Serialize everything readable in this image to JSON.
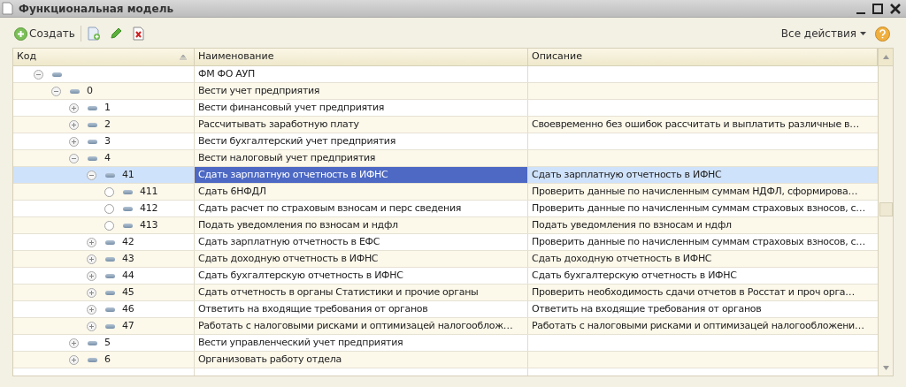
{
  "window": {
    "title": "Функциональная модель"
  },
  "toolbar": {
    "create_label": "Создать",
    "all_actions_label": "Все действия"
  },
  "table": {
    "columns": [
      {
        "label": "Код",
        "sorted": true
      },
      {
        "label": "Наименование",
        "sorted": false
      },
      {
        "label": "Описание",
        "sorted": false
      }
    ],
    "rows": [
      {
        "kind": "group",
        "expanded": true,
        "selected": false,
        "name": "ФМ ФО АУП",
        "children": [
          {
            "kind": "group",
            "expanded": true,
            "selected": false,
            "code": "0",
            "name": "Вести учет предприятия",
            "children": [
              {
                "kind": "group",
                "expanded": false,
                "selected": false,
                "code": "1",
                "name": "Вести финансовый учет предприятия"
              },
              {
                "kind": "group",
                "expanded": false,
                "selected": false,
                "code": "2",
                "name": "Рассчитывать заработную плату",
                "description": "Своевременно без ошибок рассчитать и выплатить различные в…"
              },
              {
                "kind": "group",
                "expanded": false,
                "selected": false,
                "code": "3",
                "name": "Вести бухгалтерский учет предприятия"
              },
              {
                "kind": "group",
                "expanded": true,
                "selected": false,
                "code": "4",
                "name": "Вести налоговый учет предприятия",
                "children": [
                  {
                    "kind": "group",
                    "expanded": true,
                    "selected": true,
                    "code": "41",
                    "name": "Сдать зарплатную отчетность в ИФНС",
                    "description": "Сдать зарплатную отчетность в ИФНС",
                    "children": [
                      {
                        "kind": "leaf",
                        "selected": false,
                        "code": "411",
                        "name": "Сдать 6НФДЛ",
                        "description": "Проверить данные по начисленным суммам НДФЛ, сформирова…"
                      },
                      {
                        "kind": "leaf",
                        "selected": false,
                        "code": "412",
                        "name": "Сдать расчет по страховым взносам и перс сведения",
                        "description": "Проверить данные по начисленным суммам страховых взносов, с…"
                      },
                      {
                        "kind": "leaf",
                        "selected": false,
                        "code": "413",
                        "name": "Подать уведомления по взносам и ндфл",
                        "description": "Подать уведомления по взносам и ндфл"
                      }
                    ]
                  },
                  {
                    "kind": "group",
                    "expanded": false,
                    "selected": false,
                    "code": "42",
                    "name": "Сдать зарплатную отчетность в ЕФС",
                    "description": "Проверить данные по начисленным суммам страховых взносов, с…"
                  },
                  {
                    "kind": "group",
                    "expanded": false,
                    "selected": false,
                    "code": "43",
                    "name": "Сдать доходную отчетность в ИФНС",
                    "description": "Сдать доходную отчетность в ИФНС"
                  },
                  {
                    "kind": "group",
                    "expanded": false,
                    "selected": false,
                    "code": "44",
                    "name": "Сдать бухгалтерскую отчетность в ИФНС",
                    "description": "Сдать бухгалтерскую отчетность в ИФНС"
                  },
                  {
                    "kind": "group",
                    "expanded": false,
                    "selected": false,
                    "code": "45",
                    "name": "Сдать отчетность в органы Статистики и прочие органы",
                    "description": "Проверить необходимость сдачи отчетов в Росстат и проч орга…"
                  },
                  {
                    "kind": "group",
                    "expanded": false,
                    "selected": false,
                    "code": "46",
                    "name": "Ответить на входящие требования от органов",
                    "description": "Ответить на входящие требования от органов"
                  },
                  {
                    "kind": "group",
                    "expanded": false,
                    "selected": false,
                    "code": "47",
                    "name": "Работать с налоговыми рисками и оптимизацей налогооблож…",
                    "description": "Работать с налоговыми рисками и оптимизацей налогообложени…"
                  }
                ]
              },
              {
                "kind": "group",
                "expanded": false,
                "selected": false,
                "code": "5",
                "name": "Вести управленческий учет предприятия"
              },
              {
                "kind": "group",
                "expanded": false,
                "selected": false,
                "code": "6",
                "name": "Организовать работу отдела"
              }
            ]
          }
        ]
      }
    ]
  }
}
